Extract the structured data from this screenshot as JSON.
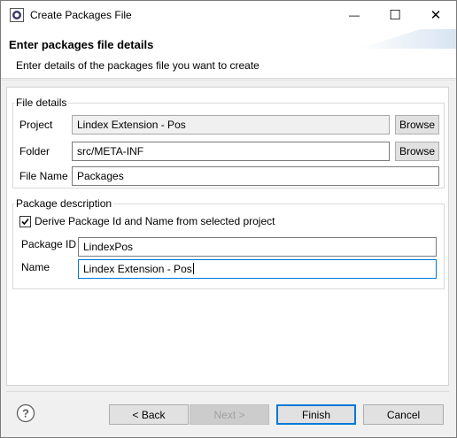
{
  "window": {
    "title": "Create Packages File",
    "minimize_glyph": "—",
    "maximize_glyph": "☐",
    "close_glyph": "✕"
  },
  "header": {
    "title": "Enter packages file details",
    "description": "Enter details of the packages file you want to create"
  },
  "file_details": {
    "group_label": "File details",
    "project_label": "Project",
    "project_value": "Lindex Extension - Pos",
    "folder_label": "Folder",
    "folder_value": "src/META-INF",
    "filename_label": "File Name",
    "filename_value": "Packages",
    "browse_label": "Browse"
  },
  "package_description": {
    "group_label": "Package description",
    "derive_checkbox_label": "Derive Package Id and Name from selected project",
    "derive_checked": true,
    "package_id_label": "Package ID",
    "package_id_value": "LindexPos",
    "name_label": "Name",
    "name_value": "Lindex Extension - Pos"
  },
  "footer": {
    "back_label": "< Back",
    "next_label": "Next >",
    "finish_label": "Finish",
    "cancel_label": "Cancel",
    "help_glyph": "?"
  },
  "colors": {
    "accent": "#0078d7",
    "dialog_bg": "#f0f0f0",
    "button_bg": "#e1e1e1"
  }
}
